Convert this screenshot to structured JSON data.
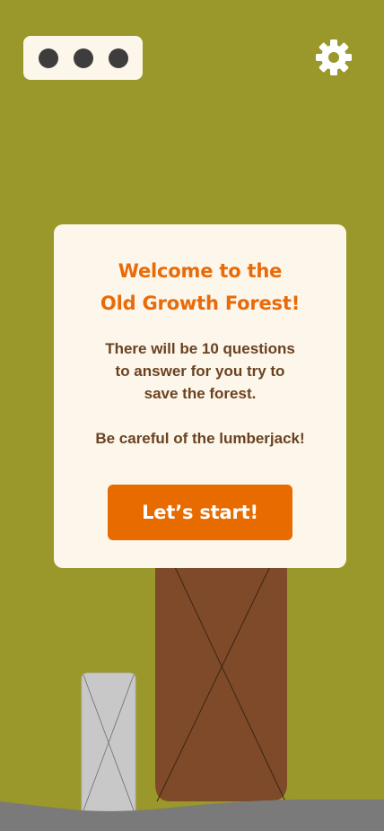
{
  "top_bar": {
    "menu_icon": "more-horizontal-icon",
    "settings_icon": "gear-icon"
  },
  "modal": {
    "title_line1": "Welcome to the",
    "title_line2": "Old Growth Forest!",
    "body_line1": "There will be 10 questions",
    "body_line2": "to answer for you try to",
    "body_line3": "save the forest.",
    "warning": "Be careful of the lumberjack!",
    "start_label": "Let’s start!"
  },
  "colors": {
    "background": "#9a972b",
    "modal_bg": "#fdf6ea",
    "accent": "#e86b00",
    "body_text": "#6a4221",
    "trunk": "#7e4a2a",
    "stump": "#c8c8c8",
    "ground": "#7a7a7a",
    "icon_dark": "#3d3d3d"
  }
}
